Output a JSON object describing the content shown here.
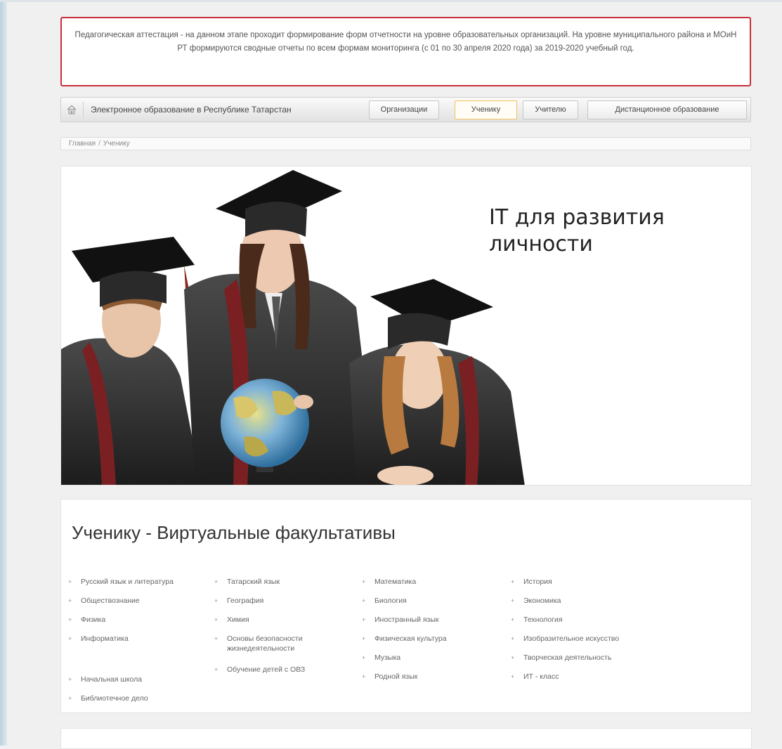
{
  "alert": {
    "text": "Педагогическая аттестация - на данном этапе проходит формирование форм отчетности на уровне образовательных организаций. На уровне муниципального района и МОиН РТ формируются сводные отчеты по всем формам мониторинга (с 01 по 30 апреля 2020 года) за 2019-2020 учебный год."
  },
  "nav": {
    "home_icon": "home-icon",
    "brand": "Электронное образование в Республике Татарстан",
    "buttons": [
      {
        "label": "Организации",
        "active": false
      },
      {
        "label": "Ученику",
        "active": true
      },
      {
        "label": "Учителю",
        "active": false
      },
      {
        "label": "Дистанционное образование",
        "active": false
      }
    ]
  },
  "breadcrumb": {
    "items": [
      "Главная",
      "Ученику"
    ],
    "separator": "/"
  },
  "banner": {
    "title": "IT для развития личности"
  },
  "panel": {
    "title": "Ученику - Виртуальные факультативы",
    "columns": [
      [
        "Русский язык и литература",
        "Обществознание",
        "Физика",
        "Информатика",
        "",
        "Начальная школа",
        "Библиотечное дело"
      ],
      [
        "Татарский язык",
        "География",
        "Химия",
        "Основы безопасности жизнедеятельности",
        "Обучение детей с ОВЗ"
      ],
      [
        "Математика",
        "Биология",
        "Иностранный язык",
        "Физическая культура",
        "Музыка",
        "Родной язык"
      ],
      [
        "История",
        "Экономика",
        "Технология",
        "Изобразительное искусство",
        "Творческая деятельность",
        "ИТ - класс"
      ]
    ]
  },
  "colors": {
    "alert_border": "#c8303b",
    "active_tab_border": "#f0c15f"
  }
}
